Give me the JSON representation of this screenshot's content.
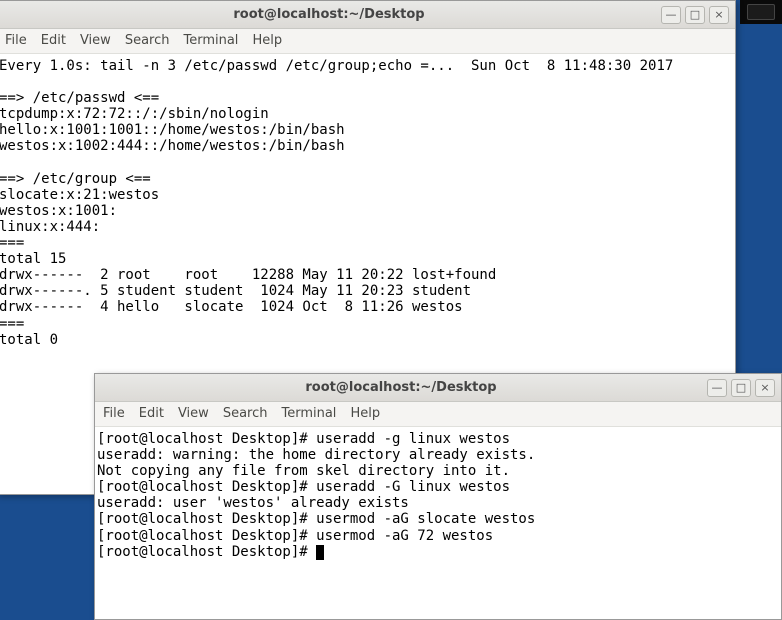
{
  "window1": {
    "title": "root@localhost:~/Desktop",
    "menu": [
      "File",
      "Edit",
      "View",
      "Search",
      "Terminal",
      "Help"
    ],
    "lines": [
      "Every 1.0s: tail -n 3 /etc/passwd /etc/group;echo =...  Sun Oct  8 11:48:30 2017",
      "",
      "==> /etc/passwd <==",
      "tcpdump:x:72:72::/:/sbin/nologin",
      "hello:x:1001:1001::/home/westos:/bin/bash",
      "westos:x:1002:444::/home/westos:/bin/bash",
      "",
      "==> /etc/group <==",
      "slocate:x:21:westos",
      "westos:x:1001:",
      "linux:x:444:",
      "===",
      "total 15",
      "drwx------  2 root    root    12288 May 11 20:22 lost+found",
      "drwx------. 5 student student  1024 May 11 20:23 student",
      "drwx------  4 hello   slocate  1024 Oct  8 11:26 westos",
      "===",
      "total 0"
    ]
  },
  "window2": {
    "title": "root@localhost:~/Desktop",
    "menu": [
      "File",
      "Edit",
      "View",
      "Search",
      "Terminal",
      "Help"
    ],
    "lines": [
      "[root@localhost Desktop]# useradd -g linux westos",
      "useradd: warning: the home directory already exists.",
      "Not copying any file from skel directory into it.",
      "[root@localhost Desktop]# useradd -G linux westos",
      "useradd: user 'westos' already exists",
      "[root@localhost Desktop]# usermod -aG slocate westos",
      "[root@localhost Desktop]# usermod -aG 72 westos",
      "[root@localhost Desktop]# "
    ]
  },
  "winbtn": {
    "min": "—",
    "max": "□",
    "close": "×"
  }
}
